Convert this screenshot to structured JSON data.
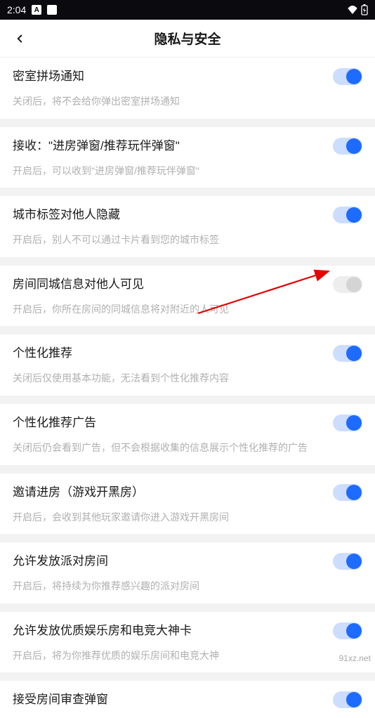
{
  "status_bar": {
    "time": "2:04",
    "indicator_letter": "A"
  },
  "header": {
    "title": "隐私与安全"
  },
  "settings": [
    {
      "title": "密室拼场通知",
      "desc": "关闭后，将不会给你弹出密室拼场通知",
      "on": true
    },
    {
      "title": "接收：\"进房弹窗/推荐玩伴弹窗\"",
      "desc": "开启后，可以收到\"进房弹窗/推荐玩伴弹窗\"",
      "on": true
    },
    {
      "title": "城市标签对他人隐藏",
      "desc": "开启后，别人不可以通过卡片看到您的城市标签",
      "on": true
    },
    {
      "title": "房间同城信息对他人可见",
      "desc": "开启后，你所在房间的同城信息将对附近的人可见",
      "on": false
    },
    {
      "title": "个性化推荐",
      "desc": "关闭后仅使用基本功能，无法看到个性化推荐内容",
      "on": true
    },
    {
      "title": "个性化推荐广告",
      "desc": "关闭后仍会看到广告，但不会根据收集的信息展示个性化推荐的广告",
      "on": true
    },
    {
      "title": "邀请进房（游戏开黑房）",
      "desc": "开启后，会收到其他玩家邀请你进入游戏开黑房间",
      "on": true
    },
    {
      "title": "允许发放派对房间",
      "desc": "开启后，将持续为你推荐感兴趣的派对房间",
      "on": true
    },
    {
      "title": "允许发放优质娱乐房和电竞大神卡",
      "desc": "开启后，将为你推荐优质的娱乐房间和电竞大神",
      "on": true
    },
    {
      "title": "接受房间审查弹窗",
      "desc": "",
      "on": true
    }
  ],
  "watermark": "91xz.net"
}
